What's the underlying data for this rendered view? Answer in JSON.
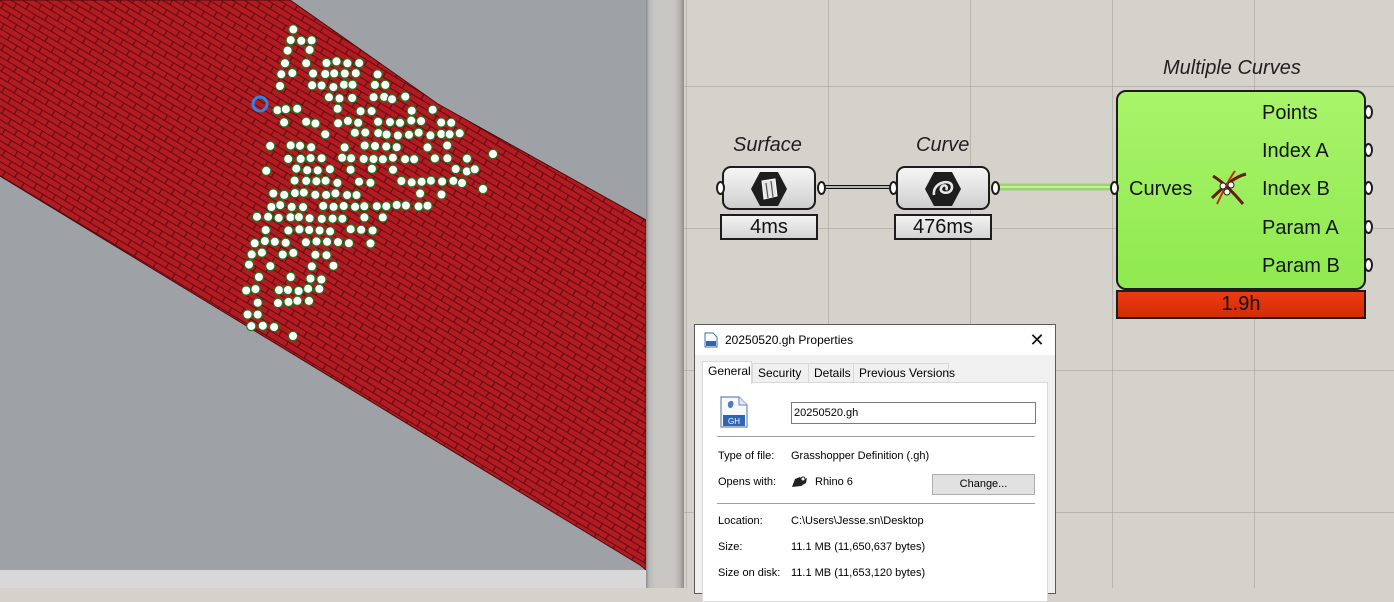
{
  "grasshopper": {
    "nodes": {
      "surface": {
        "title": "Surface",
        "timer": "4ms",
        "icon": "surface-param-icon"
      },
      "curve": {
        "title": "Curve",
        "timer": "476ms",
        "icon": "curve-param-icon"
      },
      "multiple_curves": {
        "title": "Multiple Curves",
        "input": "Curves",
        "outputs": [
          "Points",
          "Index A",
          "Index B",
          "Param A",
          "Param B"
        ],
        "timer": "1.9h",
        "icon": "multiple-curves-intersection-icon"
      }
    },
    "colors": {
      "component_green": "#96ec56",
      "timer_red": "#e0320a",
      "wire_green": "#9bd46c"
    }
  },
  "viewport": {
    "surface_color": "#b21a22",
    "point_fill": "#ffffff",
    "point_stroke": "#1e7a1e",
    "gumball_color": "#2e86de"
  },
  "dialog": {
    "title": "20250520.gh Properties",
    "tabs": [
      "General",
      "Security",
      "Details",
      "Previous Versions"
    ],
    "active_tab": "General",
    "filename": "20250520.gh",
    "file_icon_text": "GH",
    "type_label": "Type of file:",
    "type_value": "Grasshopper Definition (.gh)",
    "opens_label": "Opens with:",
    "opens_value": "Rhino 6",
    "change_label": "Change...",
    "location_label": "Location:",
    "location_value": "C:\\Users\\Jesse.sn\\Desktop",
    "size_label": "Size:",
    "size_value": "11.1 MB (11,650,637 bytes)",
    "size_on_disk_label": "Size on disk:",
    "size_on_disk_value": "11.1 MB (11,653,120 bytes)"
  }
}
